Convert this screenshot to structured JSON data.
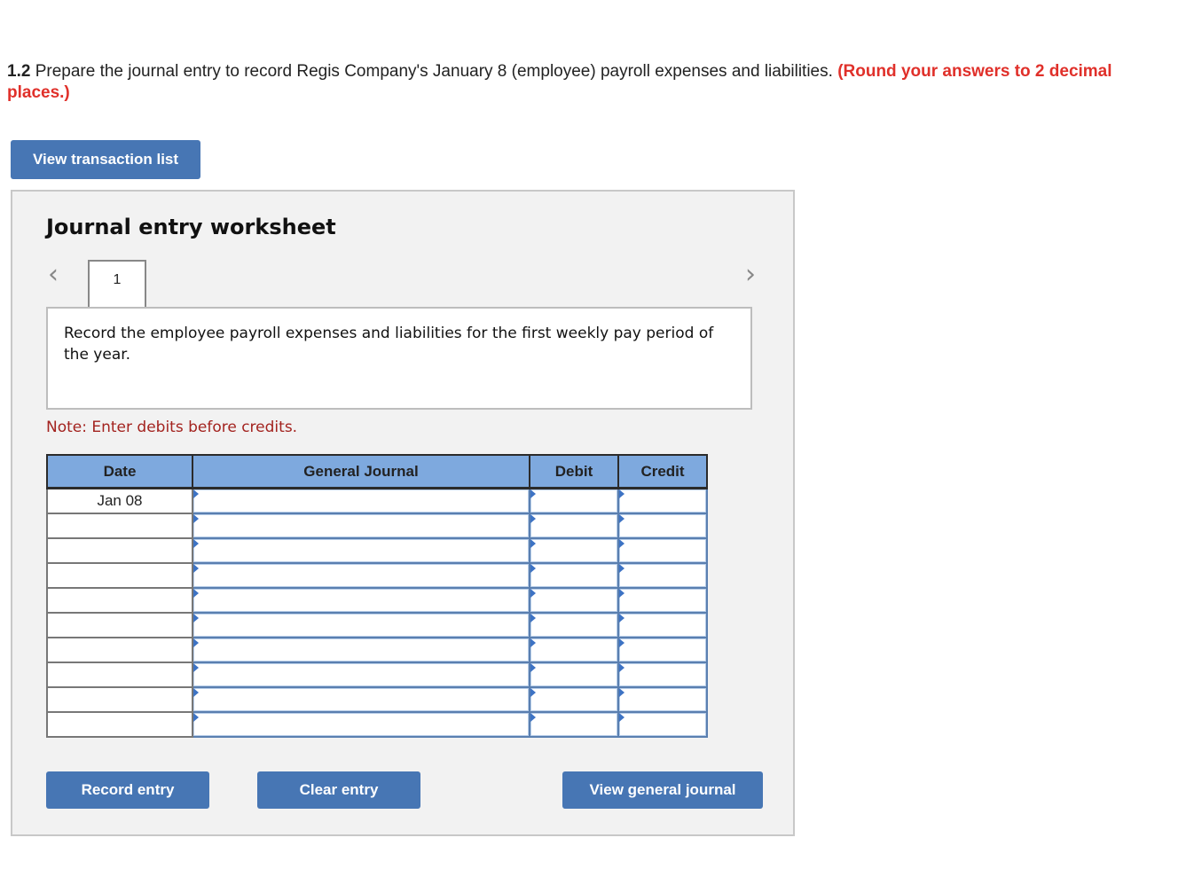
{
  "question": {
    "number": "1.2",
    "text": " Prepare the journal entry to record Regis Company's January 8 (employee) payroll expenses and liabilities. ",
    "instruction": "(Round your answers to 2 decimal places.)"
  },
  "buttons": {
    "view_transaction_list": "View transaction list",
    "record_entry": "Record entry",
    "clear_entry": "Clear entry",
    "view_general_journal": "View general journal"
  },
  "worksheet": {
    "title": "Journal entry worksheet",
    "prev_icon": "‹",
    "next_icon": "›",
    "current_tab": "1",
    "description": "Record the employee payroll expenses and liabilities for the first weekly pay period of the year.",
    "note": "Note: Enter debits before credits."
  },
  "table": {
    "headers": [
      "Date",
      "General Journal",
      "Debit",
      "Credit"
    ],
    "rows": [
      {
        "date": "Jan 08",
        "account": "",
        "debit": "",
        "credit": ""
      },
      {
        "date": "",
        "account": "",
        "debit": "",
        "credit": ""
      },
      {
        "date": "",
        "account": "",
        "debit": "",
        "credit": ""
      },
      {
        "date": "",
        "account": "",
        "debit": "",
        "credit": ""
      },
      {
        "date": "",
        "account": "",
        "debit": "",
        "credit": ""
      },
      {
        "date": "",
        "account": "",
        "debit": "",
        "credit": ""
      },
      {
        "date": "",
        "account": "",
        "debit": "",
        "credit": ""
      },
      {
        "date": "",
        "account": "",
        "debit": "",
        "credit": ""
      },
      {
        "date": "",
        "account": "",
        "debit": "",
        "credit": ""
      },
      {
        "date": "",
        "account": "",
        "debit": "",
        "credit": ""
      }
    ]
  }
}
